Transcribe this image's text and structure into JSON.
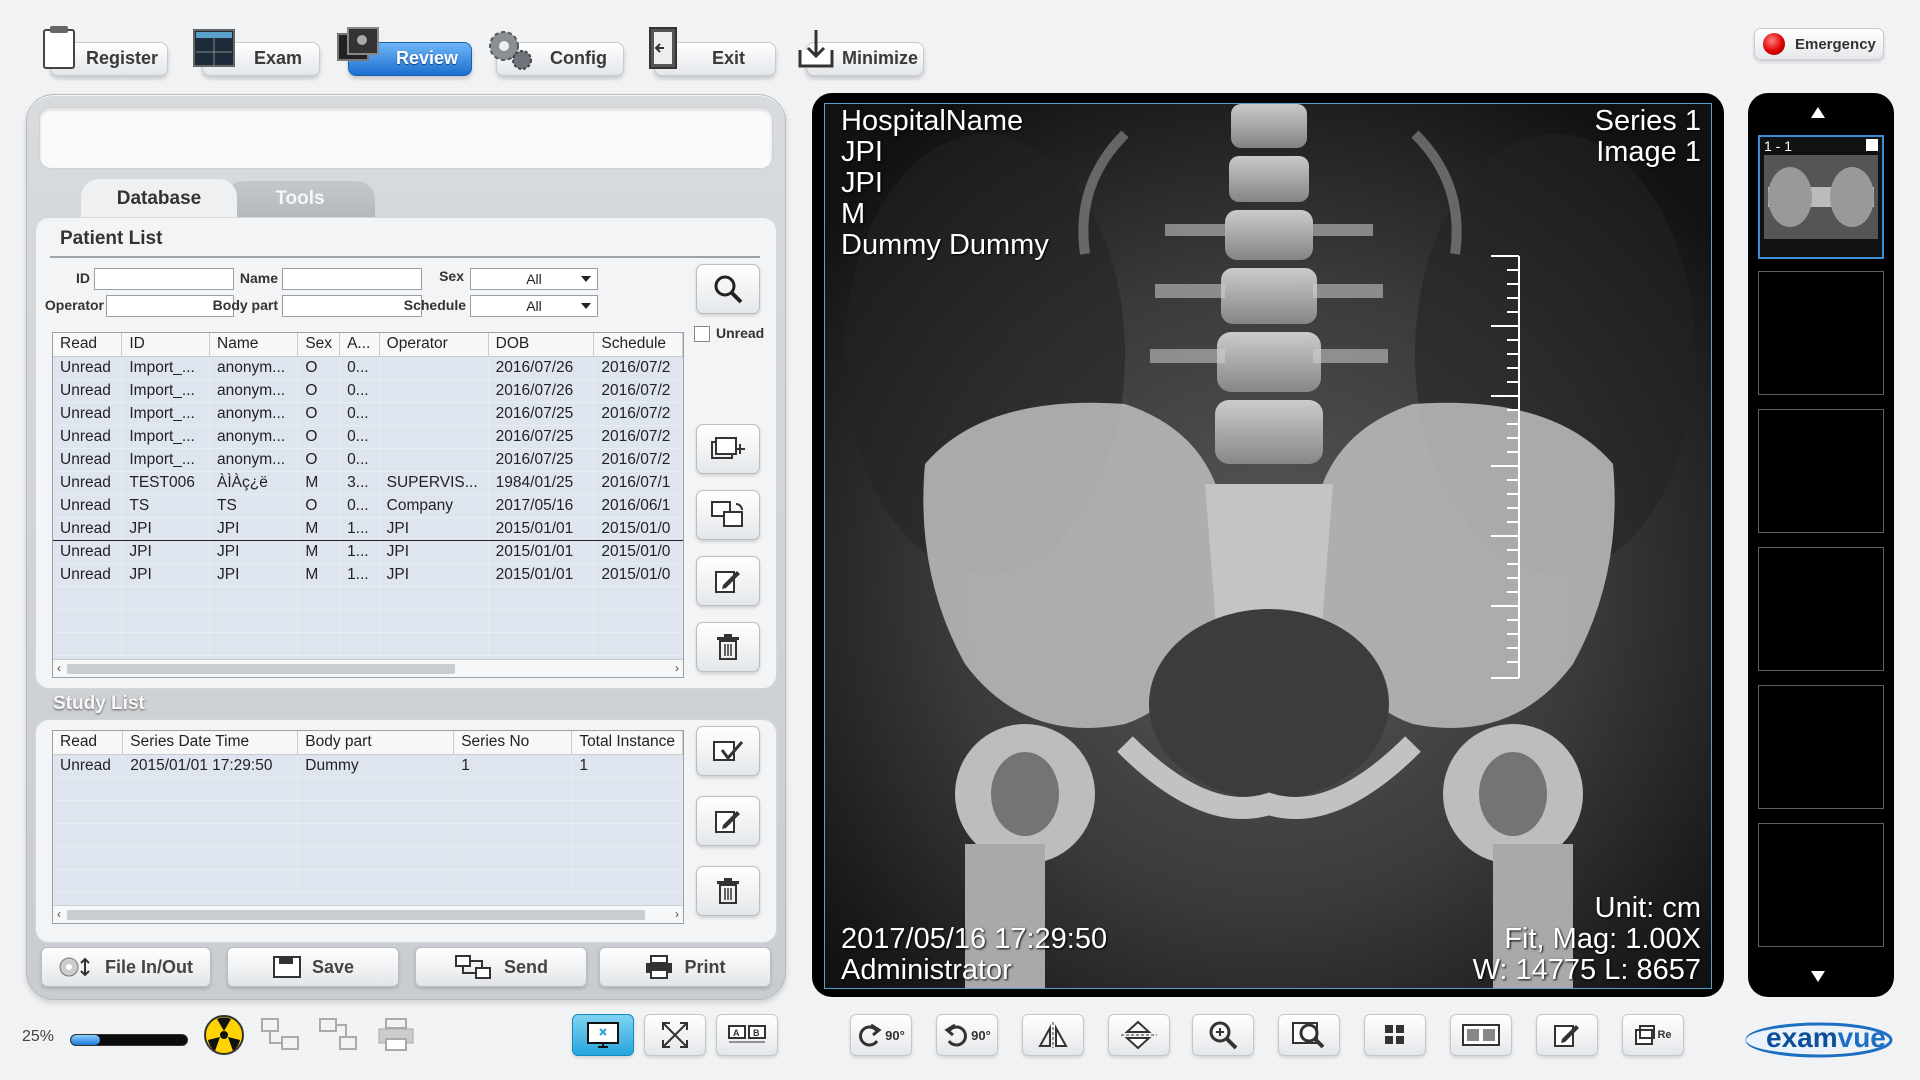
{
  "toolbar": {
    "register": "Register",
    "exam": "Exam",
    "review": "Review",
    "config": "Config",
    "exit": "Exit",
    "minimize": "Minimize",
    "emergency": "Emergency"
  },
  "tabs": {
    "database": "Database",
    "tools": "Tools"
  },
  "patient_list": {
    "title": "Patient List",
    "labels": {
      "id": "ID",
      "name": "Name",
      "sex": "Sex",
      "operator": "Operator",
      "body_part": "Body part",
      "schedule": "Schedule",
      "unread": "Unread"
    },
    "sex_value": "All",
    "schedule_value": "All",
    "columns": [
      "Read",
      "ID",
      "Name",
      "Sex",
      "A...",
      "Operator",
      "DOB",
      "Schedule"
    ],
    "rows": [
      [
        "Unread",
        "Import_...",
        "anonym...",
        "O",
        "0...",
        "",
        "2016/07/26",
        "2016/07/2"
      ],
      [
        "Unread",
        "Import_...",
        "anonym...",
        "O",
        "0...",
        "",
        "2016/07/26",
        "2016/07/2"
      ],
      [
        "Unread",
        "Import_...",
        "anonym...",
        "O",
        "0...",
        "",
        "2016/07/25",
        "2016/07/2"
      ],
      [
        "Unread",
        "Import_...",
        "anonym...",
        "O",
        "0...",
        "",
        "2016/07/25",
        "2016/07/2"
      ],
      [
        "Unread",
        "Import_...",
        "anonym...",
        "O",
        "0...",
        "",
        "2016/07/25",
        "2016/07/2"
      ],
      [
        "Unread",
        "TEST006",
        "ÀÌÀç¿ë",
        "M",
        "3...",
        "SUPERVIS...",
        "1984/01/25",
        "2016/07/1"
      ],
      [
        "Unread",
        "TS",
        "TS",
        "O",
        "0...",
        "Company",
        "2017/05/16",
        "2016/06/1"
      ],
      [
        "Unread",
        "JPI",
        "JPI",
        "M",
        "1...",
        "JPI",
        "2015/01/01",
        "2015/01/0"
      ],
      [
        "Unread",
        "JPI",
        "JPI",
        "M",
        "1...",
        "JPI",
        "2015/01/01",
        "2015/01/0"
      ],
      [
        "Unread",
        "JPI",
        "JPI",
        "M",
        "1...",
        "JPI",
        "2015/01/01",
        "2015/01/0"
      ]
    ],
    "selected_row": 7
  },
  "study_list": {
    "title": "Study List",
    "columns": [
      "Read",
      "Series Date Time",
      "Body part",
      "Series No",
      "Total Instance"
    ],
    "rows": [
      [
        "Unread",
        "2015/01/01 17:29:50",
        "Dummy",
        "1",
        "1"
      ]
    ]
  },
  "actions": {
    "file": "File In/Out",
    "save": "Save",
    "send": "Send",
    "print": "Print"
  },
  "viewer": {
    "top_left": [
      "HospitalName",
      "JPI",
      "JPI",
      "M",
      "Dummy Dummy"
    ],
    "top_right": [
      "Series 1",
      "Image 1"
    ],
    "bottom_left": [
      "2017/05/16 17:29:50",
      "Administrator"
    ],
    "bottom_right": [
      "Unit:  cm",
      "Fit, Mag: 1.00X",
      "W: 14775 L: 8657"
    ]
  },
  "thumbnails": {
    "first_label": "1 - 1"
  },
  "status": {
    "zoom": "25%",
    "progress": 0.25,
    "rotate_cw": "90°",
    "rotate_ccw": "90°",
    "re": "Re"
  },
  "logo": {
    "text_exam": "exam",
    "text_vue": "vue"
  },
  "colors": {
    "accent": "#1b6fd0",
    "grid_bg": "#dfe5ef",
    "viewer_border": "#5aa0c8"
  }
}
